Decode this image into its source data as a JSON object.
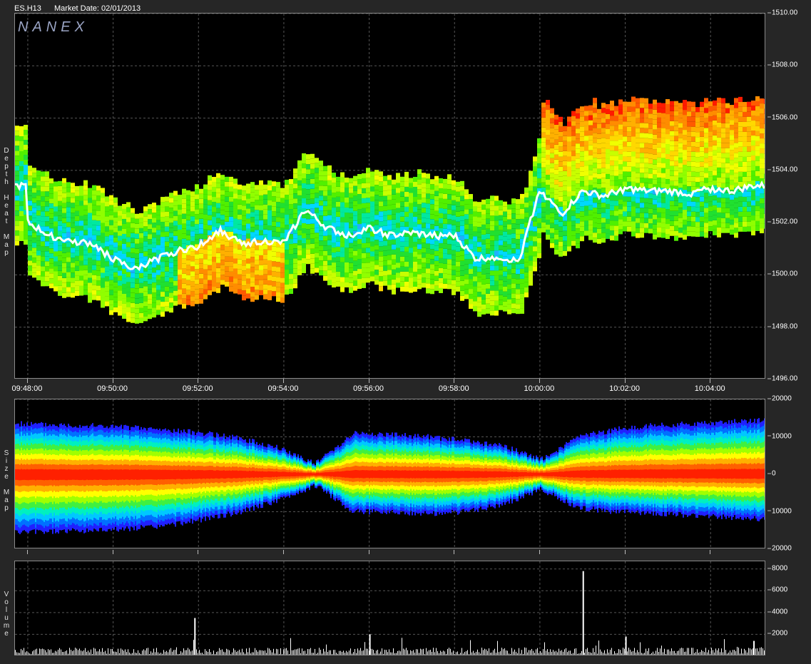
{
  "header": {
    "symbol": "ES.H13",
    "market_date": "Market Date: 02/01/2013"
  },
  "logo_text": "NANEX",
  "panels": {
    "depth": {
      "label": "D\ne\np\nt\nh\n\nH\ne\na\nt\n\nM\na\np"
    },
    "size": {
      "label": "S\ni\nz\ne\n\nM\na\np"
    },
    "volume": {
      "label": "V\no\nl\nu\nm\ne"
    }
  },
  "colors": {
    "background": "#262626",
    "plot": "#000000",
    "grid": "#555555",
    "price": "#ffffff"
  },
  "chart_data": [
    {
      "type": "heatmap",
      "title": "Depth Heat Map",
      "x_ticks": [
        "09:48:00",
        "09:50:00",
        "09:52:00",
        "09:54:00",
        "09:56:00",
        "09:58:00",
        "10:00:00",
        "10:02:00",
        "10:04:00"
      ],
      "y_ticks": [
        "1510.00",
        "1508.00",
        "1506.00",
        "1504.00",
        "1502.00",
        "1500.00",
        "1498.00",
        "1496.00"
      ],
      "ylim": [
        1496,
        1510
      ],
      "xlim_minutes": [
        -0.3,
        17.3
      ],
      "price_path": [
        [
          0,
          1502.0
        ],
        [
          1,
          1501.5
        ],
        [
          2,
          1501.3
        ],
        [
          3,
          1501.2
        ],
        [
          4,
          1500.6
        ],
        [
          5,
          1500.2
        ],
        [
          6,
          1500.6
        ],
        [
          7,
          1500.9
        ],
        [
          8,
          1501.1
        ],
        [
          9,
          1501.7
        ],
        [
          10,
          1501.2
        ],
        [
          11,
          1501.3
        ],
        [
          12,
          1501.2
        ],
        [
          13,
          1502.5
        ],
        [
          14,
          1501.8
        ],
        [
          15,
          1501.5
        ],
        [
          16,
          1501.8
        ],
        [
          17,
          1501.5
        ],
        [
          18,
          1501.6
        ],
        [
          19,
          1501.5
        ],
        [
          20,
          1501.5
        ],
        [
          21,
          1500.6
        ],
        [
          22,
          1500.7
        ],
        [
          23,
          1500.5
        ],
        [
          24,
          1503.3
        ],
        [
          25,
          1502.3
        ],
        [
          26,
          1503.2
        ],
        [
          27,
          1503.0
        ],
        [
          28,
          1503.3
        ],
        [
          29,
          1503.2
        ],
        [
          30,
          1503.2
        ],
        [
          31,
          1503.1
        ],
        [
          32,
          1503.3
        ],
        [
          33,
          1503.2
        ],
        [
          34,
          1503.4
        ]
      ],
      "grid": true
    },
    {
      "type": "area",
      "title": "Size Map",
      "y_ticks": [
        "20000",
        "10000",
        "0",
        "10000",
        "20000"
      ],
      "ylim": [
        -20000,
        20000
      ],
      "upper_envelope": [
        13500,
        13200,
        13000,
        12500,
        11800,
        11000,
        9500,
        7000,
        3000,
        11000,
        10500,
        10000,
        9000,
        7500,
        4000,
        10000,
        12000,
        13000,
        13500,
        14000,
        14500
      ],
      "lower_envelope": [
        -15500,
        -15300,
        -15000,
        -14500,
        -13800,
        -12000,
        -10000,
        -7000,
        -3000,
        -10000,
        -10000,
        -10500,
        -10000,
        -8000,
        -4000,
        -9000,
        -10000,
        -10500,
        -11000,
        -11500,
        -12000
      ],
      "grid": true
    },
    {
      "type": "bar",
      "title": "Volume",
      "y_ticks": [
        "8000",
        "6000",
        "4000",
        "2000"
      ],
      "ylim": [
        0,
        8700
      ],
      "spikes": [
        [
          3.9,
          3500
        ],
        [
          8.0,
          2000
        ],
        [
          13.0,
          7800
        ],
        [
          14.0,
          1800
        ],
        [
          17.0,
          1400
        ]
      ],
      "baseline_volume": 600,
      "grid": true
    }
  ]
}
